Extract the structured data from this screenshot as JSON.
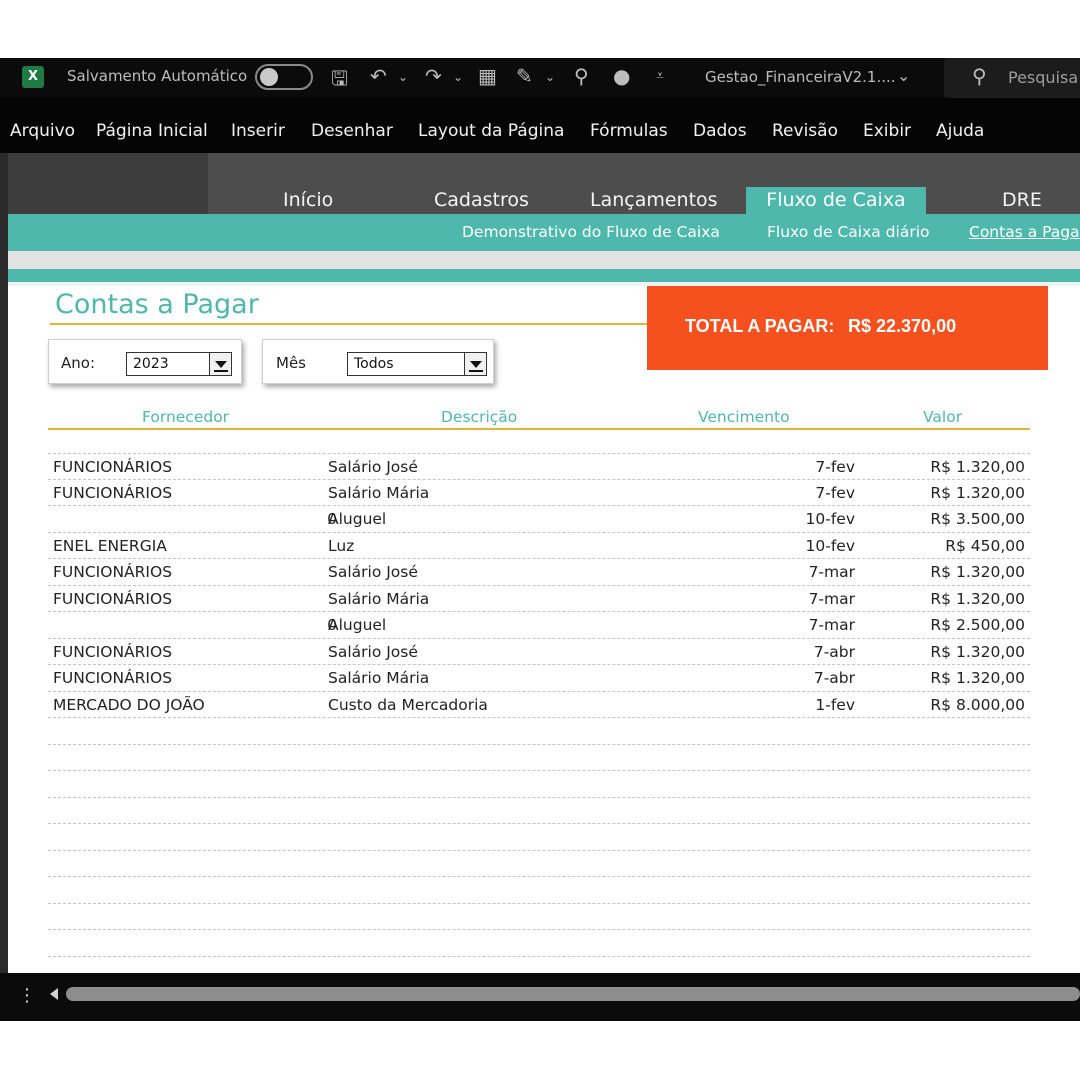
{
  "titlebar": {
    "autosave_label": "Salvamento Automático",
    "filename": "Gestao_FinanceiraV2.1....",
    "search_placeholder": "Pesquisa",
    "app_icon": "excel-icon"
  },
  "menu": {
    "items": [
      "Arquivo",
      "Página Inicial",
      "Inserir",
      "Desenhar",
      "Layout da Página",
      "Fórmulas",
      "Dados",
      "Revisão",
      "Exibir",
      "Ajuda"
    ]
  },
  "nav": {
    "tabs": [
      "Início",
      "Cadastros",
      "Lançamentos",
      "Fluxo de Caixa",
      "DRE"
    ],
    "active_tab": "Fluxo de Caixa",
    "subtabs": [
      "Demonstrativo do Fluxo de Caixa",
      "Fluxo de Caixa diário",
      "Contas a Paga"
    ],
    "active_subtab": "Contas a Paga"
  },
  "page": {
    "title": "Contas a Pagar",
    "total_label": "TOTAL A PAGAR:",
    "total_value": "R$ 22.370,00"
  },
  "filters": {
    "year_label": "Ano:",
    "year_value": "2023",
    "month_label": "Mês",
    "month_value": "Todos"
  },
  "table": {
    "headers": [
      "Fornecedor",
      "Descrição",
      "Vencimento",
      "Valor"
    ],
    "rows": [
      {
        "fornecedor": "FUNCIONÁRIOS",
        "zero": "",
        "descricao": "Salário José",
        "vencimento": "7-fev",
        "valor": "R$ 1.320,00"
      },
      {
        "fornecedor": "FUNCIONÁRIOS",
        "zero": "",
        "descricao": "Salário Mária",
        "vencimento": "7-fev",
        "valor": "R$ 1.320,00"
      },
      {
        "fornecedor": "",
        "zero": "0",
        "descricao": "Aluguel",
        "vencimento": "10-fev",
        "valor": "R$ 3.500,00"
      },
      {
        "fornecedor": "ENEL ENERGIA",
        "zero": "",
        "descricao": "Luz",
        "vencimento": "10-fev",
        "valor": "R$ 450,00"
      },
      {
        "fornecedor": "FUNCIONÁRIOS",
        "zero": "",
        "descricao": "Salário José",
        "vencimento": "7-mar",
        "valor": "R$ 1.320,00"
      },
      {
        "fornecedor": "FUNCIONÁRIOS",
        "zero": "",
        "descricao": "Salário Mária",
        "vencimento": "7-mar",
        "valor": "R$ 1.320,00"
      },
      {
        "fornecedor": "",
        "zero": "0",
        "descricao": "Aluguel",
        "vencimento": "7-mar",
        "valor": "R$ 2.500,00"
      },
      {
        "fornecedor": "FUNCIONÁRIOS",
        "zero": "",
        "descricao": "Salário José",
        "vencimento": "7-abr",
        "valor": "R$ 1.320,00"
      },
      {
        "fornecedor": "FUNCIONÁRIOS",
        "zero": "",
        "descricao": "Salário Mária",
        "vencimento": "7-abr",
        "valor": "R$ 1.320,00"
      },
      {
        "fornecedor": "MERCADO DO JOÃO",
        "zero": "",
        "descricao": "Custo da Mercadoria",
        "vencimento": "1-fev",
        "valor": "R$ 8.000,00"
      },
      {
        "fornecedor": "",
        "zero": "",
        "descricao": "",
        "vencimento": "",
        "valor": ""
      },
      {
        "fornecedor": "",
        "zero": "",
        "descricao": "",
        "vencimento": "",
        "valor": ""
      },
      {
        "fornecedor": "",
        "zero": "",
        "descricao": "",
        "vencimento": "",
        "valor": ""
      },
      {
        "fornecedor": "",
        "zero": "",
        "descricao": "",
        "vencimento": "",
        "valor": ""
      },
      {
        "fornecedor": "",
        "zero": "",
        "descricao": "",
        "vencimento": "",
        "valor": ""
      },
      {
        "fornecedor": "",
        "zero": "",
        "descricao": "",
        "vencimento": "",
        "valor": ""
      },
      {
        "fornecedor": "",
        "zero": "",
        "descricao": "",
        "vencimento": "",
        "valor": ""
      },
      {
        "fornecedor": "",
        "zero": "",
        "descricao": "",
        "vencimento": "",
        "valor": ""
      },
      {
        "fornecedor": "",
        "zero": "",
        "descricao": "",
        "vencimento": "",
        "valor": ""
      }
    ]
  },
  "colors": {
    "accent": "#4fb8ac",
    "gold_rule": "#e8b23a",
    "total_bg": "#f4511e",
    "titlebar_bg": "#0b0b0b"
  }
}
